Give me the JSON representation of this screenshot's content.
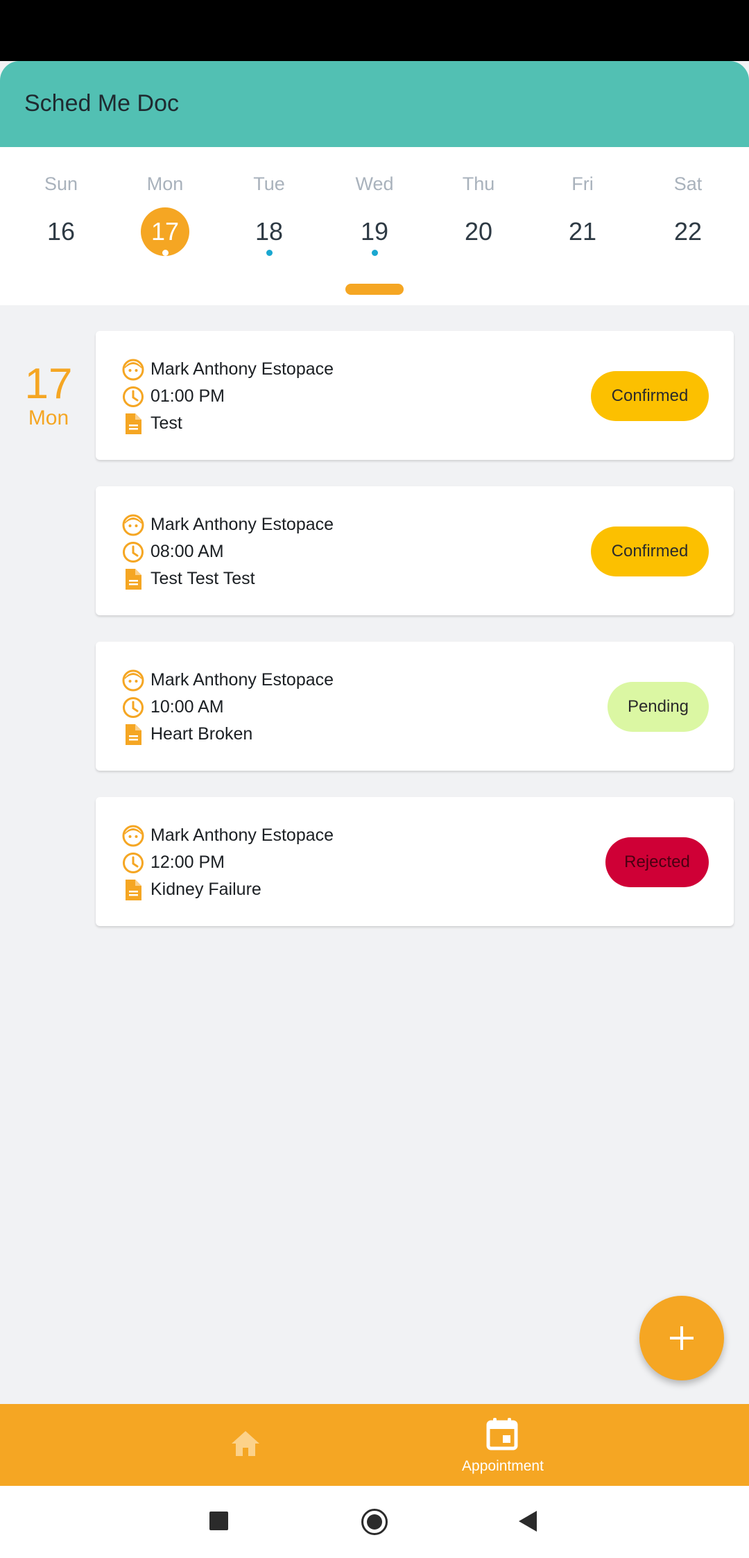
{
  "app": {
    "title": "Sched Me Doc"
  },
  "week": {
    "days": [
      {
        "name": "Sun",
        "num": "16",
        "selected": false,
        "has_event": false
      },
      {
        "name": "Mon",
        "num": "17",
        "selected": true,
        "has_event": true
      },
      {
        "name": "Tue",
        "num": "18",
        "selected": false,
        "has_event": true
      },
      {
        "name": "Wed",
        "num": "19",
        "selected": false,
        "has_event": true
      },
      {
        "name": "Thu",
        "num": "20",
        "selected": false,
        "has_event": false
      },
      {
        "name": "Fri",
        "num": "21",
        "selected": false,
        "has_event": false
      },
      {
        "name": "Sat",
        "num": "22",
        "selected": false,
        "has_event": false
      }
    ]
  },
  "selected_date": {
    "day": "17",
    "weekday": "Mon"
  },
  "appointments": [
    {
      "patient": "Mark Anthony Estopace",
      "time": "01:00 PM",
      "reason": "Test",
      "status": "Confirmed"
    },
    {
      "patient": "Mark Anthony Estopace",
      "time": "08:00 AM",
      "reason": "Test Test Test",
      "status": "Confirmed"
    },
    {
      "patient": "Mark Anthony Estopace",
      "time": "10:00 AM",
      "reason": "Heart Broken",
      "status": "Pending"
    },
    {
      "patient": "Mark Anthony Estopace",
      "time": "12:00 PM",
      "reason": "Kidney Failure",
      "status": "Rejected"
    }
  ],
  "icons": {
    "patient": "patient-face-icon",
    "time": "clock-icon",
    "reason": "document-icon",
    "fab": "add-icon",
    "home": "home-icon",
    "appointment": "calendar-icon"
  },
  "bottom_nav": {
    "appointment_label": "Appointment"
  },
  "colors": {
    "primary": "#52c0b3",
    "accent": "#f5a623",
    "confirmed": "#fcc000",
    "pending": "#dbf7a3",
    "rejected": "#cf0036",
    "event_dot": "#1aa7d0"
  }
}
